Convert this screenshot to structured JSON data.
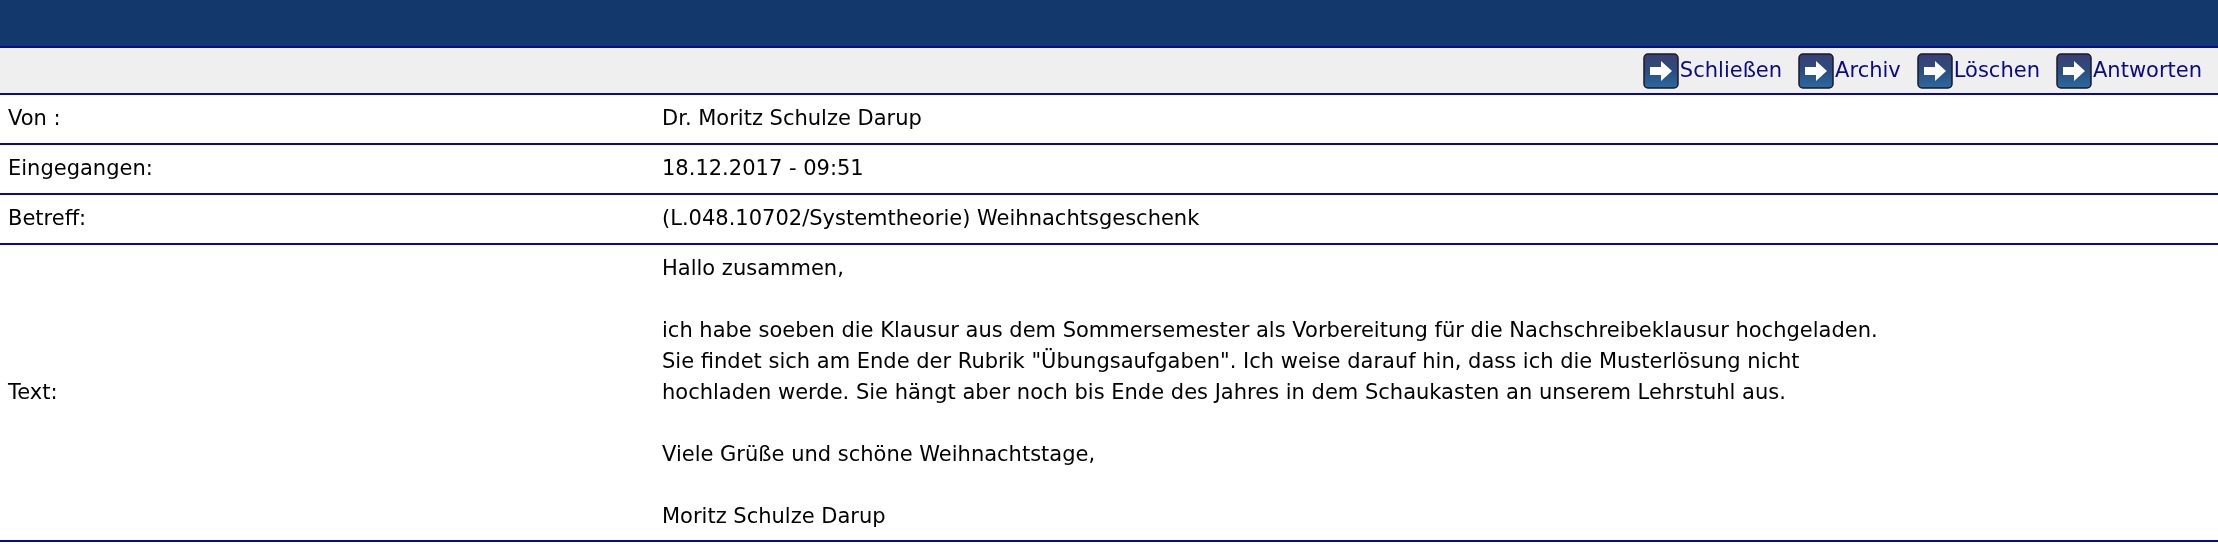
{
  "toolbar": {
    "actions": [
      {
        "label": "Schließen"
      },
      {
        "label": "Archiv"
      },
      {
        "label": "Löschen"
      },
      {
        "label": "Antworten"
      }
    ]
  },
  "fields": [
    {
      "label": "Von :",
      "value": "Dr. Moritz Schulze Darup"
    },
    {
      "label": "Eingegangen:",
      "value": "18.12.2017 - 09:51"
    },
    {
      "label": "Betreff:",
      "value": "(L.048.10702/Systemtheorie) Weihnachtsgeschenk"
    }
  ],
  "message": {
    "label": "Text:",
    "paragraphs": [
      [
        "Hallo zusammen,"
      ],
      [
        "ich habe soeben die Klausur aus dem Sommersemester als Vorbereitung für die Nachschreibeklausur hochgeladen.",
        "Sie findet sich am Ende der Rubrik \"Übungsaufgaben\". Ich weise darauf hin, dass ich die Musterlösung nicht",
        "hochladen werde. Sie hängt aber noch bis Ende des Jahres in dem Schaukasten an unserem Lehrstuhl aus."
      ],
      [
        "Viele Grüße und schöne Weihnachtstage,"
      ],
      [
        "Moritz Schulze Darup"
      ]
    ]
  }
}
